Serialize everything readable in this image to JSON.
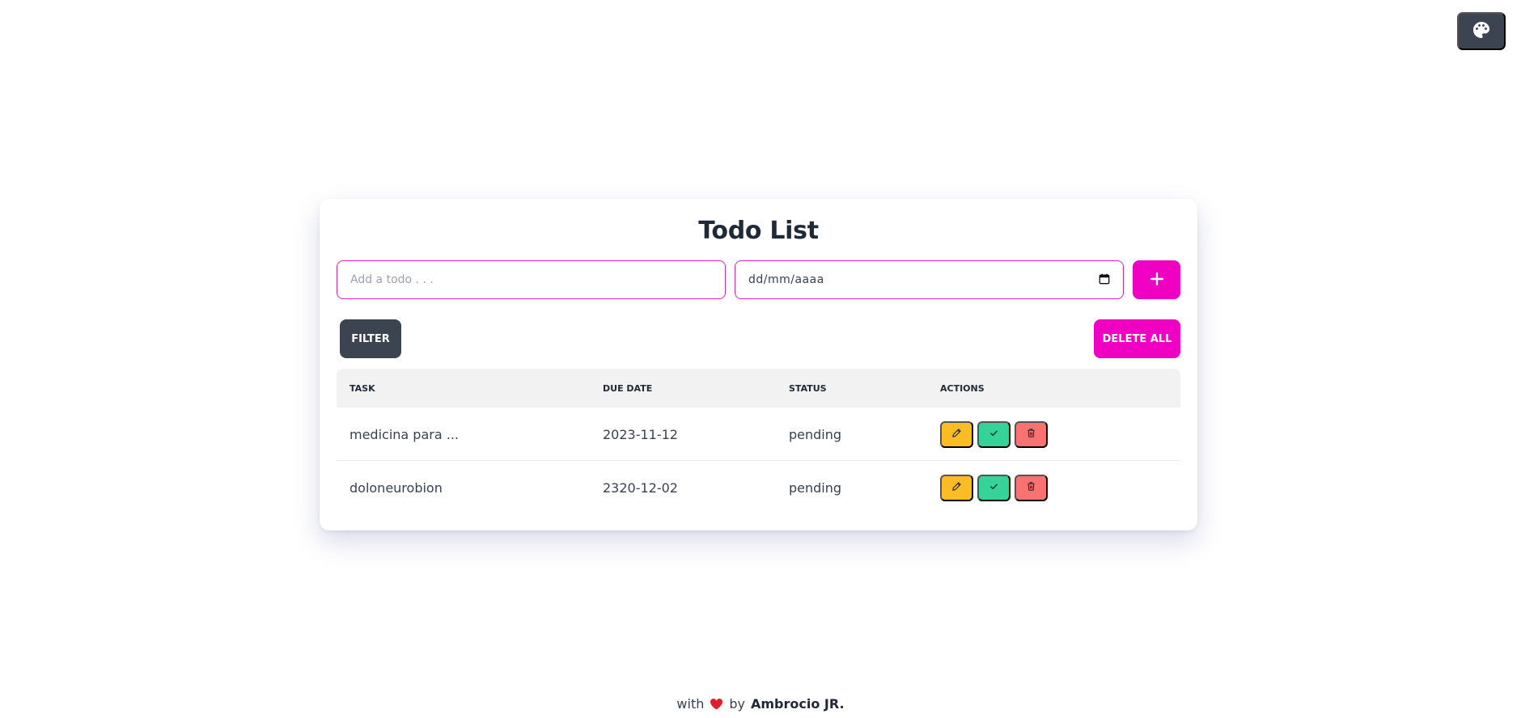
{
  "app": {
    "title": "Todo List"
  },
  "form": {
    "todo_placeholder": "Add a todo . . .",
    "date_placeholder": "dd/mm/aaaa",
    "add_label": "+"
  },
  "toolbar": {
    "filter_label": "FILTER",
    "delete_all_label": "DELETE ALL"
  },
  "table": {
    "headers": [
      "TASK",
      "DUE DATE",
      "STATUS",
      "ACTIONS"
    ],
    "rows": [
      {
        "task": "medicina para ...",
        "due_date": "2023-11-12",
        "status": "pending"
      },
      {
        "task": "doloneurobion",
        "due_date": "2320-12-02",
        "status": "pending"
      }
    ]
  },
  "footer": {
    "prefix": "with",
    "middle": "by",
    "author": "Ambrocio JR."
  },
  "icons": {
    "theme": "palette-icon",
    "calendar": "calendar-icon",
    "add": "plus-icon",
    "edit": "pencil-icon",
    "complete": "check-icon",
    "delete": "trash-icon",
    "heart": "heart-icon"
  },
  "colors": {
    "primary": "#ef00c3",
    "neutral": "#3d4451",
    "warning": "#fbbd23",
    "success": "#36d399",
    "error": "#f87272"
  }
}
